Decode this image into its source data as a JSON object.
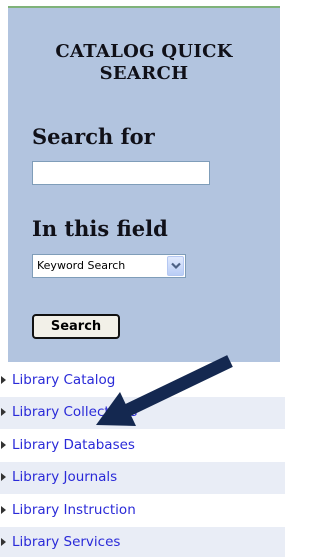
{
  "search_panel": {
    "title_line1": "CATALOG QUICK",
    "title_line2": "SEARCH",
    "search_for_label": "Search for",
    "search_input_value": "",
    "in_field_label": "In this field",
    "field_select_value": "Keyword Search",
    "search_button_label": "Search",
    "background_color": "#b2c4df"
  },
  "nav": {
    "items": [
      {
        "label": "Library Catalog"
      },
      {
        "label": "Library Collections"
      },
      {
        "label": "Library Databases"
      },
      {
        "label": "Library Journals"
      },
      {
        "label": "Library Instruction"
      },
      {
        "label": "Library Services"
      }
    ],
    "link_color": "#2a2ad8"
  },
  "annotation": {
    "arrow_icon": "arrow-pointer-icon",
    "arrow_color": "#142850"
  }
}
